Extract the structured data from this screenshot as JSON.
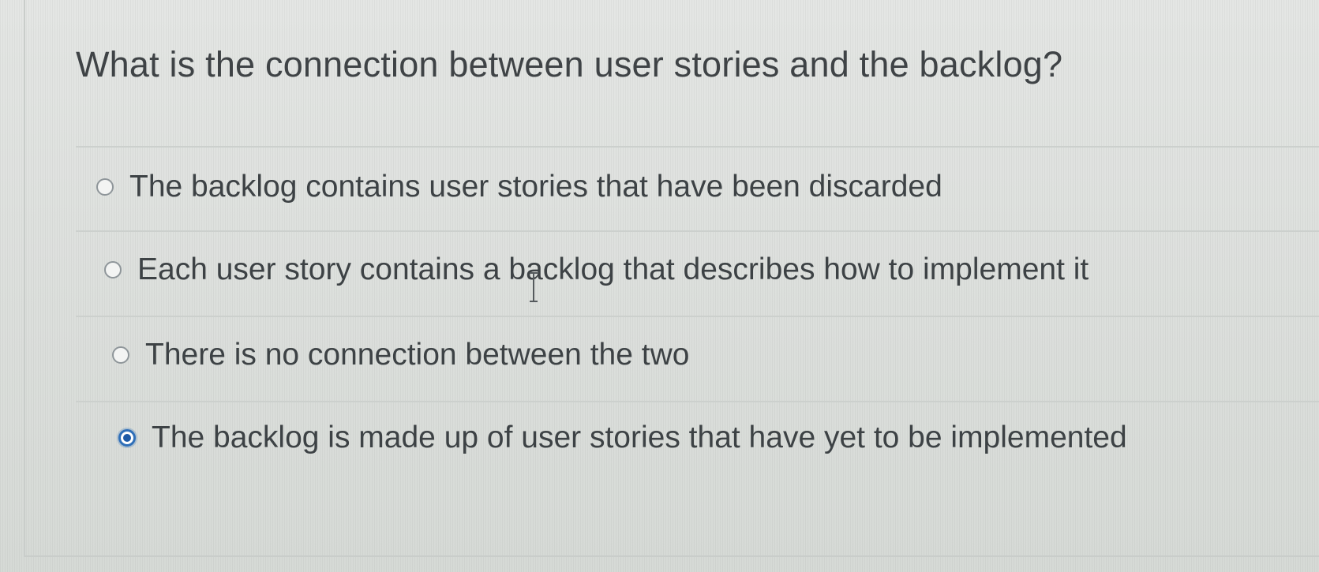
{
  "question": {
    "text": "What is the connection between user stories and the backlog?"
  },
  "answers": [
    {
      "label": "The backlog contains user stories that have been discarded",
      "selected": false
    },
    {
      "label": "Each user story contains a backlog that describes how to implement it",
      "selected": false
    },
    {
      "label": "There is no connection between the two",
      "selected": false
    },
    {
      "label": "The backlog is made up of user stories that have yet to be implemented",
      "selected": true
    }
  ],
  "colors": {
    "text": "#3f4346",
    "radio_selected": "#2f6fb8",
    "divider": "#ccd0cd"
  },
  "icons": {
    "radio_unselected": "radio-empty-icon",
    "radio_selected": "radio-filled-icon",
    "cursor": "text-cursor-icon"
  }
}
